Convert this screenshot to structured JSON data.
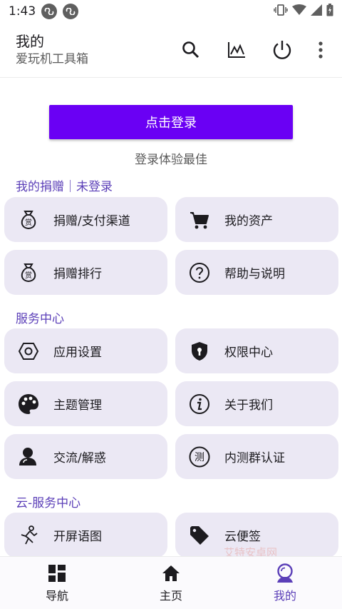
{
  "status_bar": {
    "time": "1:43"
  },
  "app_bar": {
    "title": "我的",
    "subtitle": "爱玩机工具箱"
  },
  "login": {
    "button_label": "点击登录",
    "hint": "登录体验最佳"
  },
  "sections": {
    "donate": {
      "title": "我的捐赠｜未登录",
      "items": [
        {
          "label": "捐赠/支付渠道",
          "icon": "money-bag-icon"
        },
        {
          "label": "我的资产",
          "icon": "cart-icon"
        },
        {
          "label": "捐赠排行",
          "icon": "money-bag-icon"
        },
        {
          "label": "帮助与说明",
          "icon": "help-icon"
        }
      ]
    },
    "service": {
      "title": "服务中心",
      "items": [
        {
          "label": "应用设置",
          "icon": "hexagon-settings-icon"
        },
        {
          "label": "权限中心",
          "icon": "shield-icon"
        },
        {
          "label": "主题管理",
          "icon": "palette-icon"
        },
        {
          "label": "关于我们",
          "icon": "info-icon"
        },
        {
          "label": "交流/解惑",
          "icon": "chat-users-icon"
        },
        {
          "label": "内测群认证",
          "icon": "beta-test-icon"
        }
      ]
    },
    "cloud": {
      "title": "云-服务中心",
      "items": [
        {
          "label": "开屏语图",
          "icon": "splash-figure-icon"
        },
        {
          "label": "云便签",
          "icon": "tag-icon"
        }
      ]
    }
  },
  "watermark": "艾特安卓网",
  "bottom_nav": {
    "items": [
      {
        "label": "导航",
        "icon": "grid-icon"
      },
      {
        "label": "主页",
        "icon": "home-icon"
      },
      {
        "label": "我的",
        "icon": "profile-icon"
      }
    ],
    "active": "我的"
  },
  "colors": {
    "accent": "#6a00f4",
    "section": "#5b3fb8",
    "tile_bg": "#ebe8f4"
  }
}
